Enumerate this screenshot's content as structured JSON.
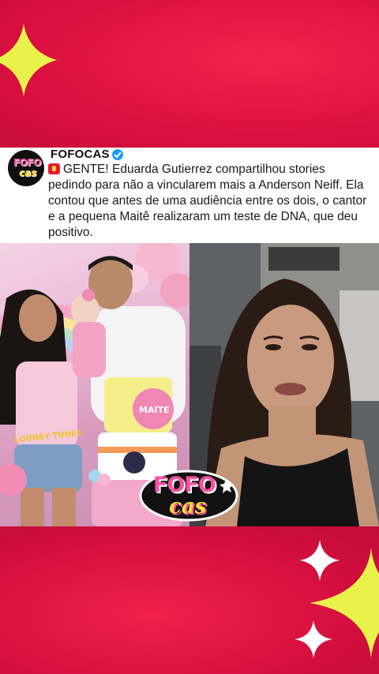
{
  "post": {
    "account_name": "FOFOCAS",
    "avatar_text_top": "FOFO",
    "avatar_text_bottom": "cas",
    "body": "GENTE! Eduarda Gutierrez compartilhou stories pedindo para não a vincularem mais a Anderson Neiff. Ela contou que antes de uma audiência entre os dois, o cantor e a pequena Maitê realizaram um teste de DNA, que deu positivo."
  },
  "left_photo": {
    "cake_name": "MAITE",
    "shirt_text": "LOONEY TUNES"
  },
  "watermark": {
    "line1": "FOFO",
    "line2": "cas"
  },
  "colors": {
    "background": "#e0143f",
    "sparkle": "#e8f24a",
    "verified": "#1d9bf0"
  }
}
